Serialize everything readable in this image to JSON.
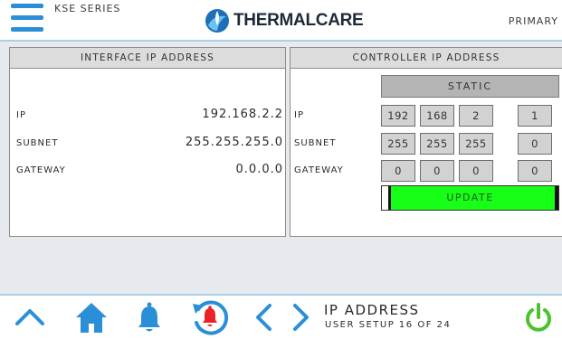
{
  "header": {
    "series": "KSE SERIES",
    "logo_text": "THERMALCARE",
    "mode": "PRIMARY"
  },
  "interface_panel": {
    "title": "INTERFACE IP ADDRESS",
    "rows": [
      {
        "label": "IP",
        "value": "192.168.2.2"
      },
      {
        "label": "SUBNET",
        "value": "255.255.255.0"
      },
      {
        "label": "GATEWAY",
        "value": "0.0.0.0"
      }
    ]
  },
  "controller_panel": {
    "title": "CONTROLLER IP ADDRESS",
    "mode_button": "STATIC",
    "rows": [
      {
        "label": "IP",
        "octets": [
          "192",
          "168",
          "2",
          "1"
        ]
      },
      {
        "label": "SUBNET",
        "octets": [
          "255",
          "255",
          "255",
          "0"
        ]
      },
      {
        "label": "GATEWAY",
        "octets": [
          "0",
          "0",
          "0",
          "0"
        ]
      }
    ],
    "update_button": "UPDATE"
  },
  "footer": {
    "screen_title": "IP ADDRESS",
    "screen_subtitle": "USER SETUP 16 OF 24"
  },
  "colors": {
    "accent": "#2b8fd8",
    "update_green": "#17ff17",
    "power_green": "#4cc22e",
    "alarm_red": "#e8232a"
  },
  "icons": [
    "menu-icon",
    "thermalcare-logo-icon",
    "up-arrow-icon",
    "home-icon",
    "bell-icon",
    "alarm-history-icon",
    "chevron-left-icon",
    "chevron-right-icon",
    "power-icon"
  ]
}
